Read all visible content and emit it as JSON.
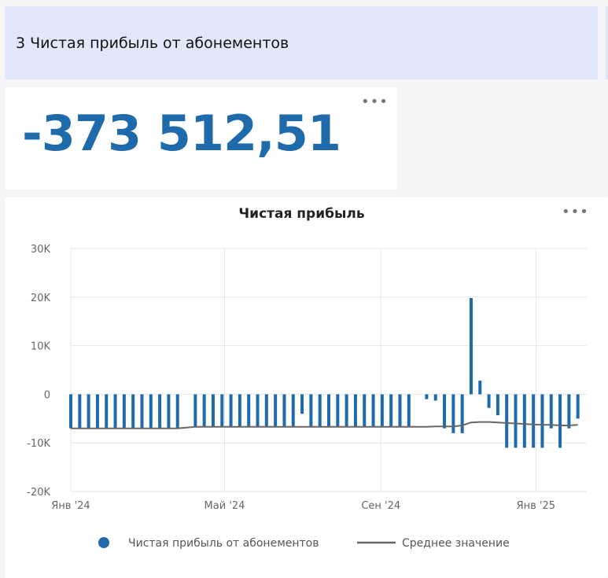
{
  "header": {
    "title": "3 Чистая прибыль от абонементов"
  },
  "kpi": {
    "value": "-373 512,51"
  },
  "colors": {
    "bar": "#1f6aab",
    "avg_line": "#666666",
    "header_bg": "#e1e8fb",
    "kpi": "#1f6aab"
  },
  "chart_data": {
    "type": "bar",
    "title": "Чистая прибыль",
    "xlabel": "",
    "ylabel": "",
    "ylim": [
      -20000,
      30000
    ],
    "yticks": [
      30000,
      20000,
      10000,
      0,
      -10000,
      -20000
    ],
    "ytick_labels": [
      "30K",
      "20K",
      "10K",
      "0",
      "-10K",
      "-20K"
    ],
    "xtick_labels": [
      "Янв '24",
      "Май '24",
      "Сен '24",
      "Янв '25"
    ],
    "xlim": [
      "2024-01-01",
      "2025-02-10"
    ],
    "x": [
      "2024-01-01",
      "2024-01-08",
      "2024-01-15",
      "2024-01-22",
      "2024-01-29",
      "2024-02-05",
      "2024-02-12",
      "2024-02-19",
      "2024-02-26",
      "2024-03-04",
      "2024-03-11",
      "2024-03-18",
      "2024-03-25",
      "2024-04-08",
      "2024-04-15",
      "2024-04-22",
      "2024-04-29",
      "2024-05-06",
      "2024-05-13",
      "2024-05-20",
      "2024-05-27",
      "2024-06-03",
      "2024-06-10",
      "2024-06-17",
      "2024-06-24",
      "2024-07-01",
      "2024-07-08",
      "2024-07-15",
      "2024-07-22",
      "2024-07-29",
      "2024-08-05",
      "2024-08-12",
      "2024-08-19",
      "2024-08-26",
      "2024-09-02",
      "2024-09-09",
      "2024-09-16",
      "2024-09-23",
      "2024-10-07",
      "2024-10-14",
      "2024-10-21",
      "2024-10-28",
      "2024-11-04",
      "2024-11-11",
      "2024-11-18",
      "2024-11-25",
      "2024-12-02",
      "2024-12-09",
      "2024-12-16",
      "2024-12-23",
      "2024-12-30",
      "2025-01-06",
      "2025-01-13",
      "2025-01-20",
      "2025-01-27",
      "2025-02-03"
    ],
    "series": [
      {
        "name": "Чистая прибыль от абонементов",
        "kind": "bar",
        "values": [
          -7000,
          -7000,
          -7000,
          -7000,
          -7000,
          -7000,
          -7000,
          -7000,
          -7000,
          -7000,
          -7000,
          -7000,
          -7000,
          -6800,
          -6800,
          -6800,
          -6800,
          -6800,
          -6800,
          -6800,
          -6800,
          -6800,
          -6800,
          -6800,
          -6800,
          -4000,
          -6800,
          -6800,
          -6800,
          -6800,
          -6800,
          -6800,
          -6800,
          -6800,
          -6800,
          -6800,
          -6800,
          -6800,
          -1000,
          -1300,
          -7000,
          -8000,
          -8000,
          19800,
          2800,
          -2800,
          -4300,
          -11000,
          -11000,
          -11000,
          -11000,
          -11000,
          -7000,
          -11000,
          -7000,
          -5000,
          -4200
        ]
      },
      {
        "name": "Среднее значение",
        "kind": "line",
        "values": [
          -7000,
          -7000,
          -7000,
          -7000,
          -7000,
          -7000,
          -7000,
          -7000,
          -7000,
          -7000,
          -7000,
          -7000,
          -7000,
          -6700,
          -6700,
          -6700,
          -6700,
          -6700,
          -6700,
          -6700,
          -6700,
          -6700,
          -6700,
          -6700,
          -6700,
          -6700,
          -6700,
          -6700,
          -6700,
          -6700,
          -6700,
          -6700,
          -6700,
          -6700,
          -6700,
          -6700,
          -6700,
          -6700,
          -6700,
          -6600,
          -6600,
          -6600,
          -6400,
          -5800,
          -5700,
          -5700,
          -5800,
          -5900,
          -6000,
          -6100,
          -6200,
          -6300,
          -6300,
          -6400,
          -6400,
          -6300,
          -6300
        ]
      }
    ],
    "legend_position": "bottom",
    "grid": true
  }
}
